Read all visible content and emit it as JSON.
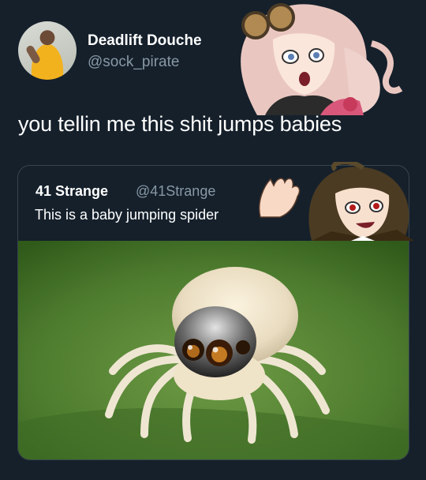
{
  "tweet": {
    "display_name": "Deadlift Douche",
    "handle": "@sock_pirate",
    "text": "you tellin me this shit jumps babies"
  },
  "quoted_tweet": {
    "display_name": "41 Strange",
    "handle": "@41Strange",
    "text": "This is a baby jumping spider"
  },
  "colors": {
    "background": "#15202b",
    "secondary_text": "#8899a6",
    "border": "#38444d"
  }
}
